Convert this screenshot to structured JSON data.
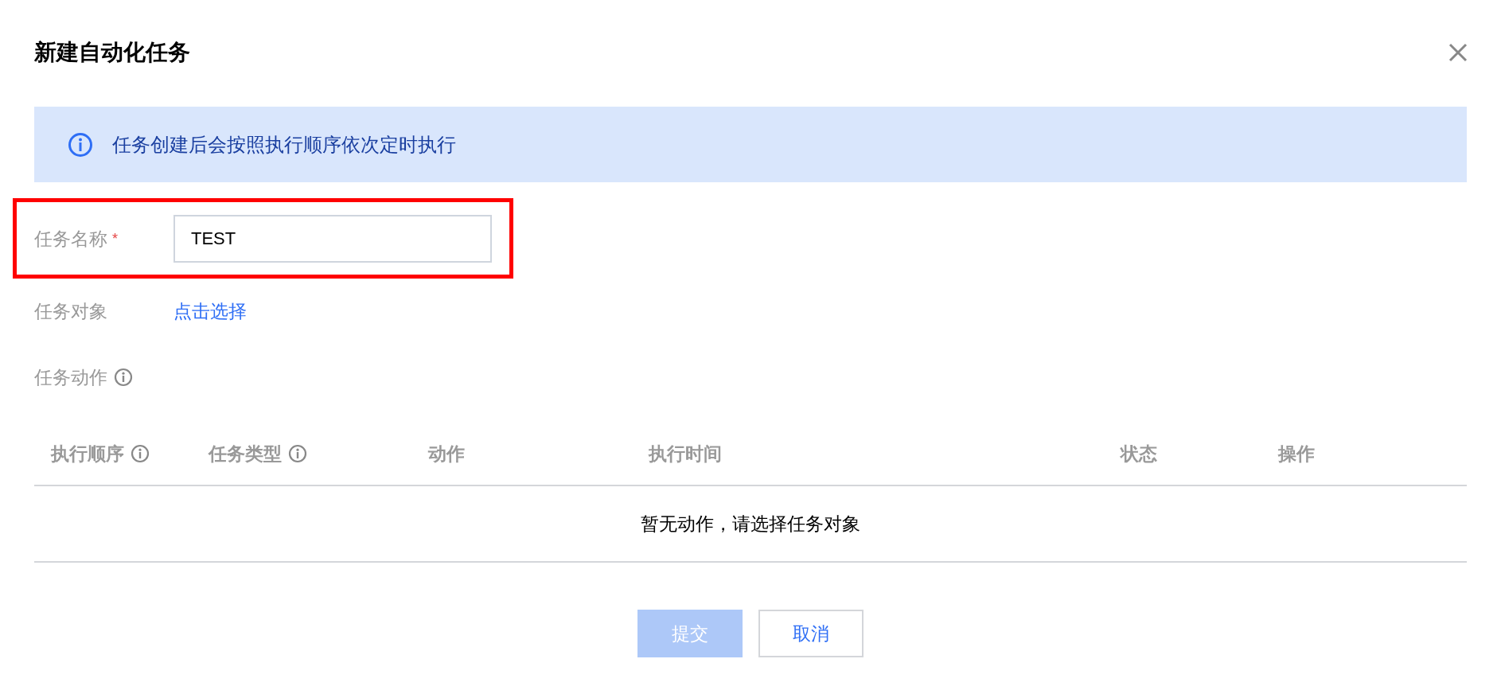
{
  "dialog": {
    "title": "新建自动化任务"
  },
  "alert": {
    "text": "任务创建后会按照执行顺序依次定时执行"
  },
  "form": {
    "task_name": {
      "label": "任务名称",
      "required_mark": "*",
      "value": "TEST",
      "highlighted": true
    },
    "task_target": {
      "label": "任务对象",
      "link": "点击选择"
    },
    "task_action": {
      "label": "任务动作",
      "info": true
    }
  },
  "table": {
    "columns": [
      {
        "label": "执行顺序",
        "info": true
      },
      {
        "label": "任务类型",
        "info": true
      },
      {
        "label": "动作",
        "info": false
      },
      {
        "label": "执行时间",
        "info": false
      },
      {
        "label": "状态",
        "info": false
      },
      {
        "label": "操作",
        "info": false
      }
    ],
    "empty_text": "暂无动作，请选择任务对象"
  },
  "buttons": [
    {
      "label": "提交",
      "kind": "primary",
      "disabled": true
    },
    {
      "label": "取消",
      "kind": "secondary",
      "disabled": false
    }
  ]
}
